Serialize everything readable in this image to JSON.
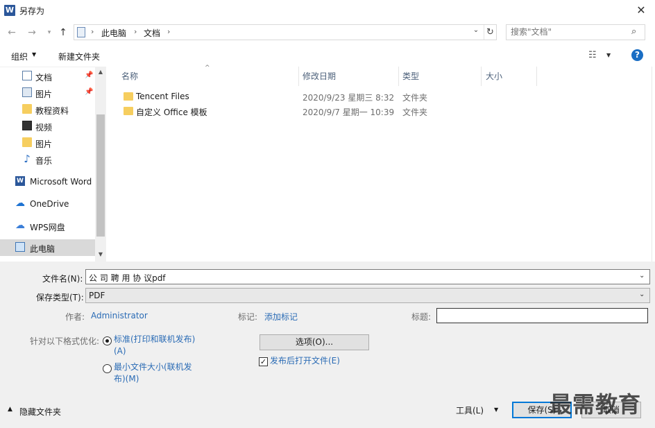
{
  "window": {
    "title": "另存为",
    "app_icon_letter": "W",
    "close_glyph": "✕"
  },
  "address": {
    "crumbs": [
      "此电脑",
      "文档"
    ],
    "separator": "›",
    "search_placeholder": "搜索\"文档\""
  },
  "toolbar": {
    "organize_label": "组织",
    "new_folder_label": "新建文件夹",
    "help_label": "?"
  },
  "nav": {
    "items": [
      {
        "label": "文档",
        "icon": "document-icon",
        "pinned": true
      },
      {
        "label": "图片",
        "icon": "picture-icon",
        "pinned": true
      },
      {
        "label": "教程资料",
        "icon": "folder-icon",
        "pinned": false
      },
      {
        "label": "视频",
        "icon": "video-icon",
        "pinned": false
      },
      {
        "label": "图片",
        "icon": "folder-icon",
        "pinned": false
      },
      {
        "label": "音乐",
        "icon": "music-icon",
        "pinned": false
      },
      {
        "label": "Microsoft Word",
        "icon": "word-icon",
        "pinned": false
      },
      {
        "label": "OneDrive",
        "icon": "onedrive-icon",
        "pinned": false
      },
      {
        "label": "WPS网盘",
        "icon": "wps-cloud-icon",
        "pinned": false
      },
      {
        "label": "此电脑",
        "icon": "computer-icon",
        "pinned": false,
        "selected": true
      }
    ]
  },
  "files": {
    "columns": [
      "名称",
      "修改日期",
      "类型",
      "大小"
    ],
    "rows": [
      {
        "name": "Tencent Files",
        "date": "2020/9/23 星期三 8:32",
        "type": "文件夹",
        "size": ""
      },
      {
        "name": "自定义 Office 模板",
        "date": "2020/9/7 星期一 10:39",
        "type": "文件夹",
        "size": ""
      }
    ]
  },
  "save": {
    "filename_label": "文件名(N):",
    "filename_value": "公 司 聘 用 协 议pdf",
    "type_label": "保存类型(T):",
    "type_value": "PDF",
    "author_label": "作者:",
    "author_value": "Administrator",
    "tags_label": "标记:",
    "tags_value": "添加标记",
    "title_label": "标题:",
    "title_value": "",
    "optimize_label": "针对以下格式优化:",
    "optimize_options": [
      {
        "line1": "标准(打印和联机发布)",
        "line2": "(A)",
        "selected": true
      },
      {
        "line1": "最小文件大小(联机发",
        "line2": "布)(M)",
        "selected": false
      }
    ],
    "options_button": "选项(O)...",
    "open_after_label": "发布后打开文件(E)",
    "open_after_checked": true,
    "hide_folders_label": "隐藏文件夹",
    "tools_label": "工具(L)",
    "save_button": "保存(S)",
    "cancel_button": "取消"
  },
  "watermark": "最需教育",
  "colors": {
    "link_blue": "#2a6bb5",
    "folder_yellow": "#f6ce5f",
    "selection_gray": "#d9d9d9",
    "panel_gray": "#f0f0f0"
  }
}
